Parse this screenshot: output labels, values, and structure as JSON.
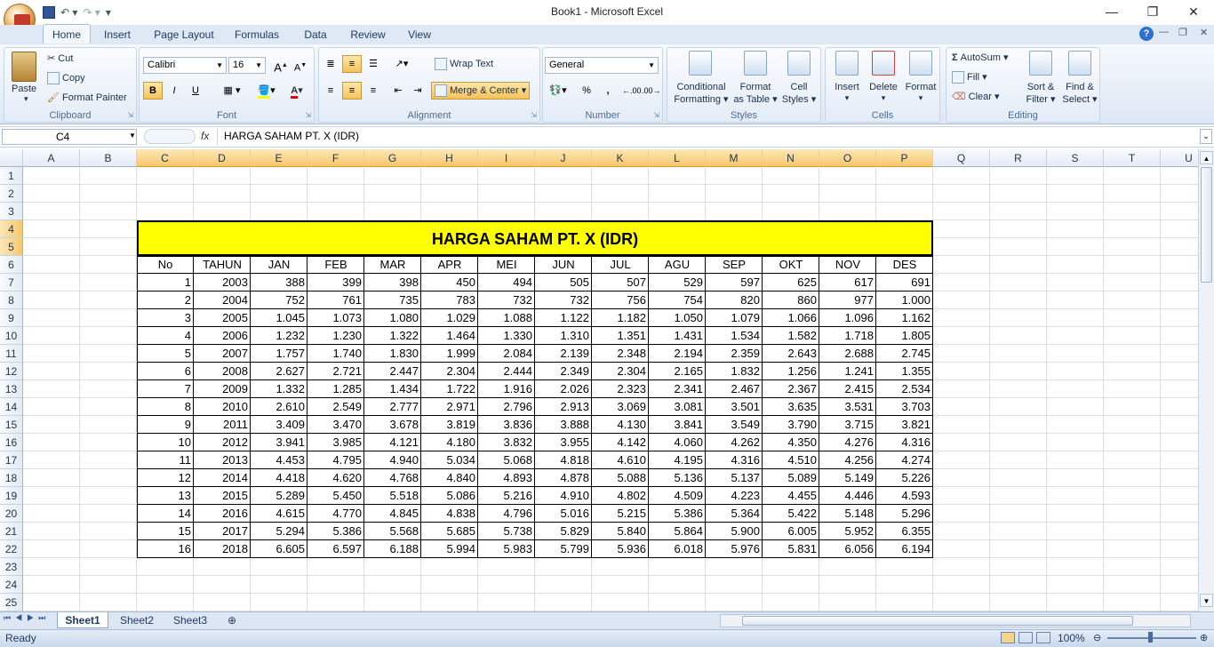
{
  "window": {
    "title": "Book1 - Microsoft Excel"
  },
  "ribbon_tabs": [
    "Home",
    "Insert",
    "Page Layout",
    "Formulas",
    "Data",
    "Review",
    "View"
  ],
  "clipboard": {
    "paste": "Paste",
    "cut": "Cut",
    "copy": "Copy",
    "format_painter": "Format Painter",
    "group": "Clipboard"
  },
  "font": {
    "name": "Calibri",
    "size": "16",
    "bold": "B",
    "italic": "I",
    "underline": "U",
    "group": "Font"
  },
  "alignment": {
    "wrap": "Wrap Text",
    "merge": "Merge & Center",
    "group": "Alignment"
  },
  "number": {
    "format": "General",
    "percent": "%",
    "comma": ",",
    "inc": ".00",
    "dec": ".00",
    "group": "Number"
  },
  "styles": {
    "cond1": "Conditional",
    "cond2": "Formatting",
    "fmt1": "Format",
    "fmt2": "as Table",
    "cell1": "Cell",
    "cell2": "Styles",
    "group": "Styles"
  },
  "cells": {
    "insert": "Insert",
    "delete": "Delete",
    "format": "Format",
    "group": "Cells"
  },
  "editing": {
    "autosum": "AutoSum",
    "fill": "Fill",
    "clear": "Clear",
    "sort1": "Sort &",
    "sort2": "Filter",
    "find1": "Find &",
    "find2": "Select",
    "group": "Editing"
  },
  "formula_bar": {
    "name_box": "C4",
    "fx": "fx",
    "content": "HARGA SAHAM PT. X (IDR)"
  },
  "columns": [
    "A",
    "B",
    "C",
    "D",
    "E",
    "F",
    "G",
    "H",
    "I",
    "J",
    "K",
    "L",
    "M",
    "N",
    "O",
    "P",
    "Q",
    "R",
    "S",
    "T",
    "U"
  ],
  "rows": [
    "1",
    "2",
    "3",
    "4",
    "5",
    "6",
    "7",
    "8",
    "9",
    "10",
    "11",
    "12",
    "13",
    "14",
    "15",
    "16",
    "17",
    "18",
    "19",
    "20",
    "21",
    "22",
    "23",
    "24",
    "25"
  ],
  "table": {
    "title": "HARGA SAHAM PT. X (IDR)",
    "headers": [
      "No",
      "TAHUN",
      "JAN",
      "FEB",
      "MAR",
      "APR",
      "MEI",
      "JUN",
      "JUL",
      "AGU",
      "SEP",
      "OKT",
      "NOV",
      "DES"
    ],
    "rows": [
      [
        "1",
        "2003",
        "388",
        "399",
        "398",
        "450",
        "494",
        "505",
        "507",
        "529",
        "597",
        "625",
        "617",
        "691"
      ],
      [
        "2",
        "2004",
        "752",
        "761",
        "735",
        "783",
        "732",
        "732",
        "756",
        "754",
        "820",
        "860",
        "977",
        "1.000"
      ],
      [
        "3",
        "2005",
        "1.045",
        "1.073",
        "1.080",
        "1.029",
        "1.088",
        "1.122",
        "1.182",
        "1.050",
        "1.079",
        "1.066",
        "1.096",
        "1.162"
      ],
      [
        "4",
        "2006",
        "1.232",
        "1.230",
        "1.322",
        "1.464",
        "1.330",
        "1.310",
        "1.351",
        "1.431",
        "1.534",
        "1.582",
        "1.718",
        "1.805"
      ],
      [
        "5",
        "2007",
        "1.757",
        "1.740",
        "1.830",
        "1.999",
        "2.084",
        "2.139",
        "2.348",
        "2.194",
        "2.359",
        "2.643",
        "2.688",
        "2.745"
      ],
      [
        "6",
        "2008",
        "2.627",
        "2.721",
        "2.447",
        "2.304",
        "2.444",
        "2.349",
        "2.304",
        "2.165",
        "1.832",
        "1.256",
        "1.241",
        "1.355"
      ],
      [
        "7",
        "2009",
        "1.332",
        "1.285",
        "1.434",
        "1.722",
        "1.916",
        "2.026",
        "2.323",
        "2.341",
        "2.467",
        "2.367",
        "2.415",
        "2.534"
      ],
      [
        "8",
        "2010",
        "2.610",
        "2.549",
        "2.777",
        "2.971",
        "2.796",
        "2.913",
        "3.069",
        "3.081",
        "3.501",
        "3.635",
        "3.531",
        "3.703"
      ],
      [
        "9",
        "2011",
        "3.409",
        "3.470",
        "3.678",
        "3.819",
        "3.836",
        "3.888",
        "4.130",
        "3.841",
        "3.549",
        "3.790",
        "3.715",
        "3.821"
      ],
      [
        "10",
        "2012",
        "3.941",
        "3.985",
        "4.121",
        "4.180",
        "3.832",
        "3.955",
        "4.142",
        "4.060",
        "4.262",
        "4.350",
        "4.276",
        "4.316"
      ],
      [
        "11",
        "2013",
        "4.453",
        "4.795",
        "4.940",
        "5.034",
        "5.068",
        "4.818",
        "4.610",
        "4.195",
        "4.316",
        "4.510",
        "4.256",
        "4.274"
      ],
      [
        "12",
        "2014",
        "4.418",
        "4.620",
        "4.768",
        "4.840",
        "4.893",
        "4.878",
        "5.088",
        "5.136",
        "5.137",
        "5.089",
        "5.149",
        "5.226"
      ],
      [
        "13",
        "2015",
        "5.289",
        "5.450",
        "5.518",
        "5.086",
        "5.216",
        "4.910",
        "4.802",
        "4.509",
        "4.223",
        "4.455",
        "4.446",
        "4.593"
      ],
      [
        "14",
        "2016",
        "4.615",
        "4.770",
        "4.845",
        "4.838",
        "4.796",
        "5.016",
        "5.215",
        "5.386",
        "5.364",
        "5.422",
        "5.148",
        "5.296"
      ],
      [
        "15",
        "2017",
        "5.294",
        "5.386",
        "5.568",
        "5.685",
        "5.738",
        "5.829",
        "5.840",
        "5.864",
        "5.900",
        "6.005",
        "5.952",
        "6.355"
      ],
      [
        "16",
        "2018",
        "6.605",
        "6.597",
        "6.188",
        "5.994",
        "5.983",
        "5.799",
        "5.936",
        "6.018",
        "5.976",
        "5.831",
        "6.056",
        "6.194"
      ]
    ]
  },
  "sheets": [
    "Sheet1",
    "Sheet2",
    "Sheet3"
  ],
  "status": {
    "mode": "Ready",
    "zoom": "100%"
  }
}
